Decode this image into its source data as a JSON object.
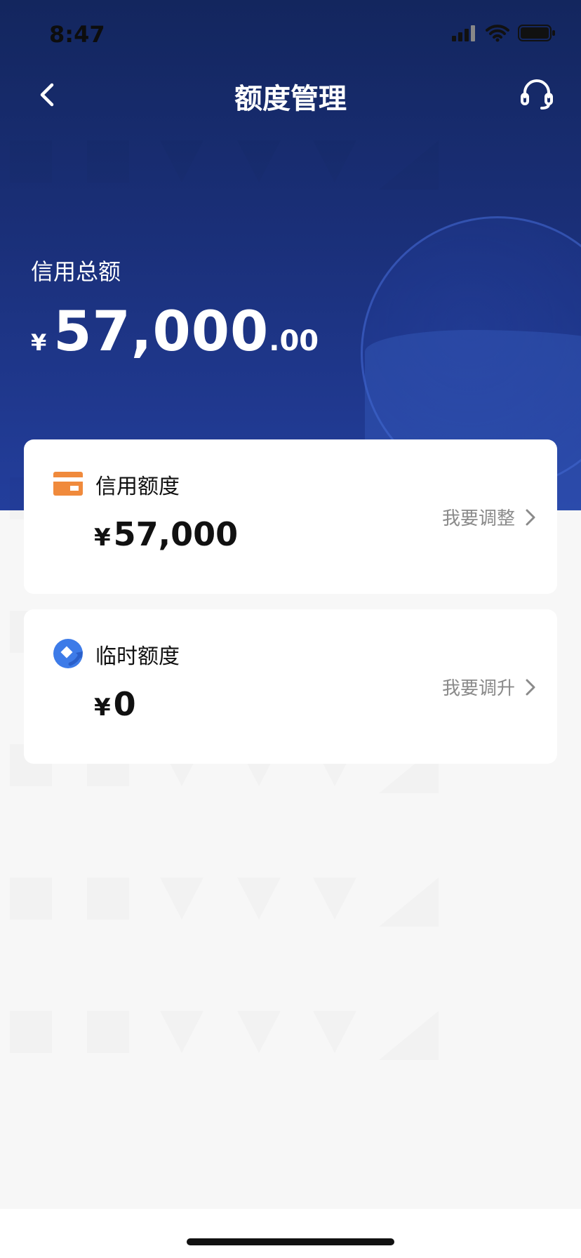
{
  "status_bar": {
    "time": "8:47",
    "icons": [
      "signal-icon",
      "wifi-icon",
      "battery-icon"
    ]
  },
  "nav": {
    "title": "额度管理",
    "back_icon": "chevron-left-icon",
    "support_icon": "headset-icon"
  },
  "summary": {
    "label": "信用总额",
    "currency": "¥",
    "amount_int": "57,000",
    "amount_dec": ".00"
  },
  "cards": [
    {
      "icon": "credit-card-icon",
      "title": "信用额度",
      "currency": "¥",
      "amount": "57,000",
      "action_label": "我要调整",
      "action_icon": "chevron-right-icon"
    },
    {
      "icon": "temporary-quota-icon",
      "title": "临时额度",
      "currency": "¥",
      "amount": "0",
      "action_label": "我要调升",
      "action_icon": "chevron-right-icon"
    }
  ],
  "colors": {
    "hero_top": "#13265e",
    "hero_bottom": "#233e9c",
    "card_icon_orange": "#f08a3c",
    "card_icon_blue": "#3d7be8",
    "action_text": "#8a8a8a"
  }
}
